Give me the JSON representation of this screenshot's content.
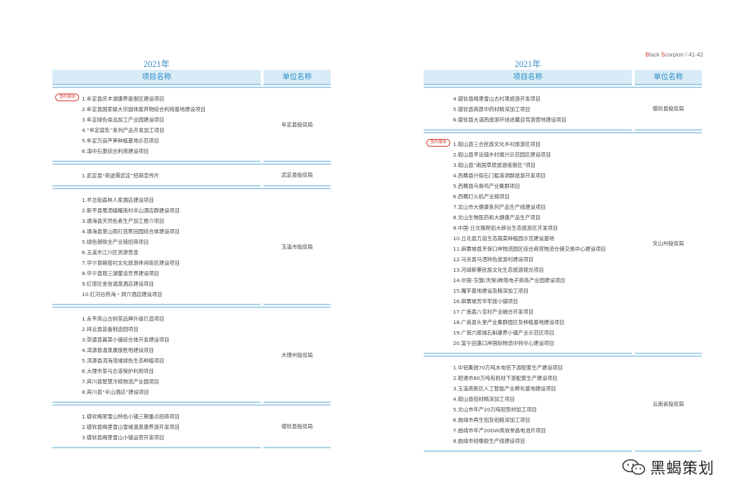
{
  "brand": {
    "prefix": "B",
    "text": "lack ",
    "s": "S",
    "rest": "corpion / 41-42"
  },
  "left": {
    "year": "2021年",
    "col_project": "项目名称",
    "col_unit": "单位名称",
    "groups": [
      {
        "badge": "签约落地",
        "unit": "牟定县投促局",
        "items": [
          "1.牟定县庆丰湖康养度假区建设项目",
          "2.牟定县国家级大宗固体废弃物综合利用基地建设项目",
          "3.牟定绿色食品加工产业园建设项目",
          "4.“牟定腐乳”系列产品开发加工项目",
          "5.牟定万亩芦笋种植基地示范项目",
          "6.滇中石墨综合利用建设项目"
        ]
      },
      {
        "badge": "",
        "unit": "武定县投促局",
        "items": [
          "1.武定县“商途需武定”招商宣传片"
        ]
      },
      {
        "badge": "",
        "unit": "玉溪市投促局",
        "items": [
          "1.羊岔街森林人家酒店建设项目",
          "2.新平县戛洒镇耀南村半山酒店群建设项目",
          "3.通海县天然色素生产加工推介项目",
          "4.通海县里山雨打芭蕉田园综合体建设项目",
          "5.绿色钢铁全产业链招商项目",
          "6.玉溪市江川区资源普查",
          "7.华宁县碗窑村文化旅游休闲街区建设项目",
          "8.华宁县观三湖童话世界建设项目",
          "9.红塔区金信温泉酒店建设项目",
          "10.红河谷热海・洞穴酒店建设项目"
        ]
      },
      {
        "badge": "",
        "unit": "大理州投促局",
        "items": [
          "1.永平高山古树茶品牌升级打造项目",
          "2.祥云县装备制造园项目",
          "3.弥渡县酱菜小镇综合体开发建设项目",
          "4.洱源县温泉康旅胜地建设项目",
          "5.洱源县洱海流域绿色生态种植项目",
          "6.大理市茶马古道保护利用项目",
          "7.宾川县智慧冷链物流产业园项目",
          "8.宾川县“半山酒店”建设项目"
        ]
      },
      {
        "badge": "",
        "unit": "德钦县投促局",
        "items": [
          "1.德钦梅里雪山特色小镇三期重点招商项目",
          "2.德钦县梅里雪山雪域温泉康养游开发项目",
          "3.德钦县梅里雪山小镇运营开发项目"
        ]
      }
    ]
  },
  "right": {
    "year": "2021年",
    "col_project": "项目名称",
    "col_unit": "单位名称",
    "groups": [
      {
        "badge": "",
        "unit": "德钦县投促局",
        "items": [
          "4.德钦县梅里雪山古村落旅游开发项目",
          "5.德钦县高原中药材精深加工项目",
          "6.德钦县大滇西旅游环线进藏自驾游营地建设项目"
        ]
      },
      {
        "badge": "签约落地",
        "unit": "文山州投促局",
        "items": [
          "1.砚山县三合民族文化乡村旅游区项目",
          "2.砚山县平远镇乡村振兴示范园区建设项目",
          "3.砚山县“南国草原旅游度假区”项目",
          "4.西畴县兴街石门槛溶洞群旅游开发项目",
          "5.西畴县乌骨鸡产业集群项目",
          "6.西畴打火机产业链项目",
          "7.文山市大健康系列产品生产线建设项目",
          "8.文山生物医药和大健康产品生产项目",
          "9.中国-丘北猴爬岩大峡谷生态旅游区开发项目",
          "10.丘北县万亩生态蔬菜种植园示范建设基地",
          "11.麻栗坡县天保口岸物流园区综合商贸物流仓储交易中心建设项目",
          "12.马关县马洒特色旅游村建设项目",
          "13.河靖新寨民族文化生态旅游观光项目",
          "14.中国-东盟(天保)跨境电子商务产业园建设项目",
          "15.魔芋基地建设及精深加工项目",
          "16.麻栗坡芳华军旅小镇项目",
          "17.广南县八宝村产业融合开发项目",
          "18.广南县头堂产业集群园区及种植基地建设项目",
          "19.广南六郎城石斛康养小镇产业示范区项目",
          "20.富宁田蓬口岸国际物流中转中心建设项目"
        ]
      },
      {
        "badge": "",
        "unit": "云南省投促局",
        "items": [
          "1.中铝集团70万吨水电铝下游配套生产建设项目",
          "2.昭通市80万吨有机硅下游配套生产建设项目",
          "3.玉溪高新区人工智能产业孵化基地建设项目",
          "4.砚山县铝材精深加工项目",
          "5.文山市年产20万吨铝型材加工项目",
          "6.曲靖市再生铝及铝精深加工项目",
          "7.曲靖市年产20GW高效单晶电池片项目",
          "8.曲靖市硅橡胶生产线建设项目"
        ]
      }
    ]
  },
  "watermark": {
    "text": "黑蝎策划",
    "icon": "wechat-icon"
  }
}
